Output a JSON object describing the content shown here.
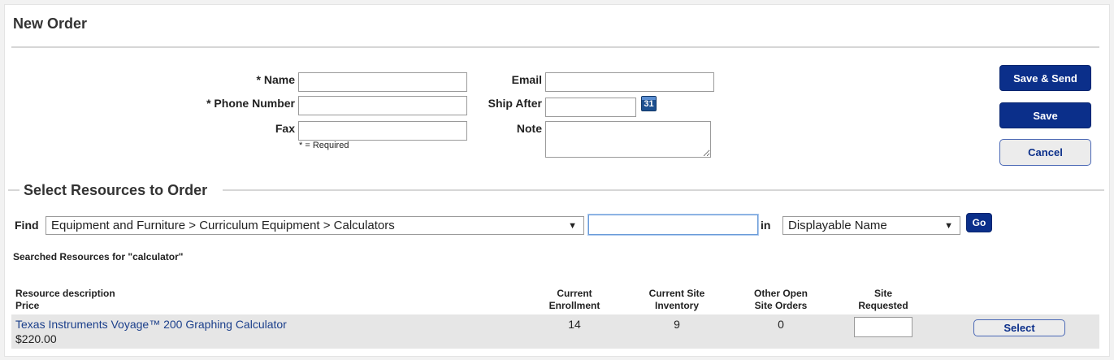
{
  "page": {
    "title": "New Order"
  },
  "form": {
    "name_label": "* Name",
    "name_value": "",
    "phone_label": "* Phone Number",
    "phone_value": "",
    "fax_label": "Fax",
    "fax_value": "",
    "required_note": "* = Required",
    "email_label": "Email",
    "email_value": "",
    "ship_after_label": "Ship After",
    "ship_after_value": "",
    "calendar_day": "31",
    "note_label": "Note",
    "note_value": ""
  },
  "actions": {
    "save_send": "Save & Send",
    "save": "Save",
    "cancel": "Cancel"
  },
  "resources": {
    "section_title": "Select Resources to Order",
    "find_label": "Find",
    "category_selected": "Equipment and Furniture > Curriculum Equipment > Calculators",
    "search_value": "",
    "in_label": "in",
    "field_selected": "Displayable Name",
    "go": "Go",
    "searched_caption": "Searched Resources for \"calculator\""
  },
  "table": {
    "headers": {
      "description_line1": "Resource description",
      "description_line2": "Price",
      "enrollment_line1": "Current",
      "enrollment_line2": "Enrollment",
      "inventory_line1": "Current Site",
      "inventory_line2": "Inventory",
      "open_orders_line1": "Other Open",
      "open_orders_line2": "Site Orders",
      "requested_line1": "Site",
      "requested_line2": "Requested"
    },
    "rows": [
      {
        "name": "Texas Instruments Voyage™ 200 Graphing Calculator",
        "price": "$220.00",
        "enrollment": "14",
        "inventory": "9",
        "open_orders": "0",
        "requested": "",
        "action": "Select"
      }
    ]
  },
  "colors": {
    "primary_button": "#0b2f8a",
    "link": "#1b3f8b",
    "row_highlight": "#e6e6e6"
  },
  "icons": {
    "calendar": "calendar-icon",
    "dropdown": "chevron-down-icon"
  }
}
